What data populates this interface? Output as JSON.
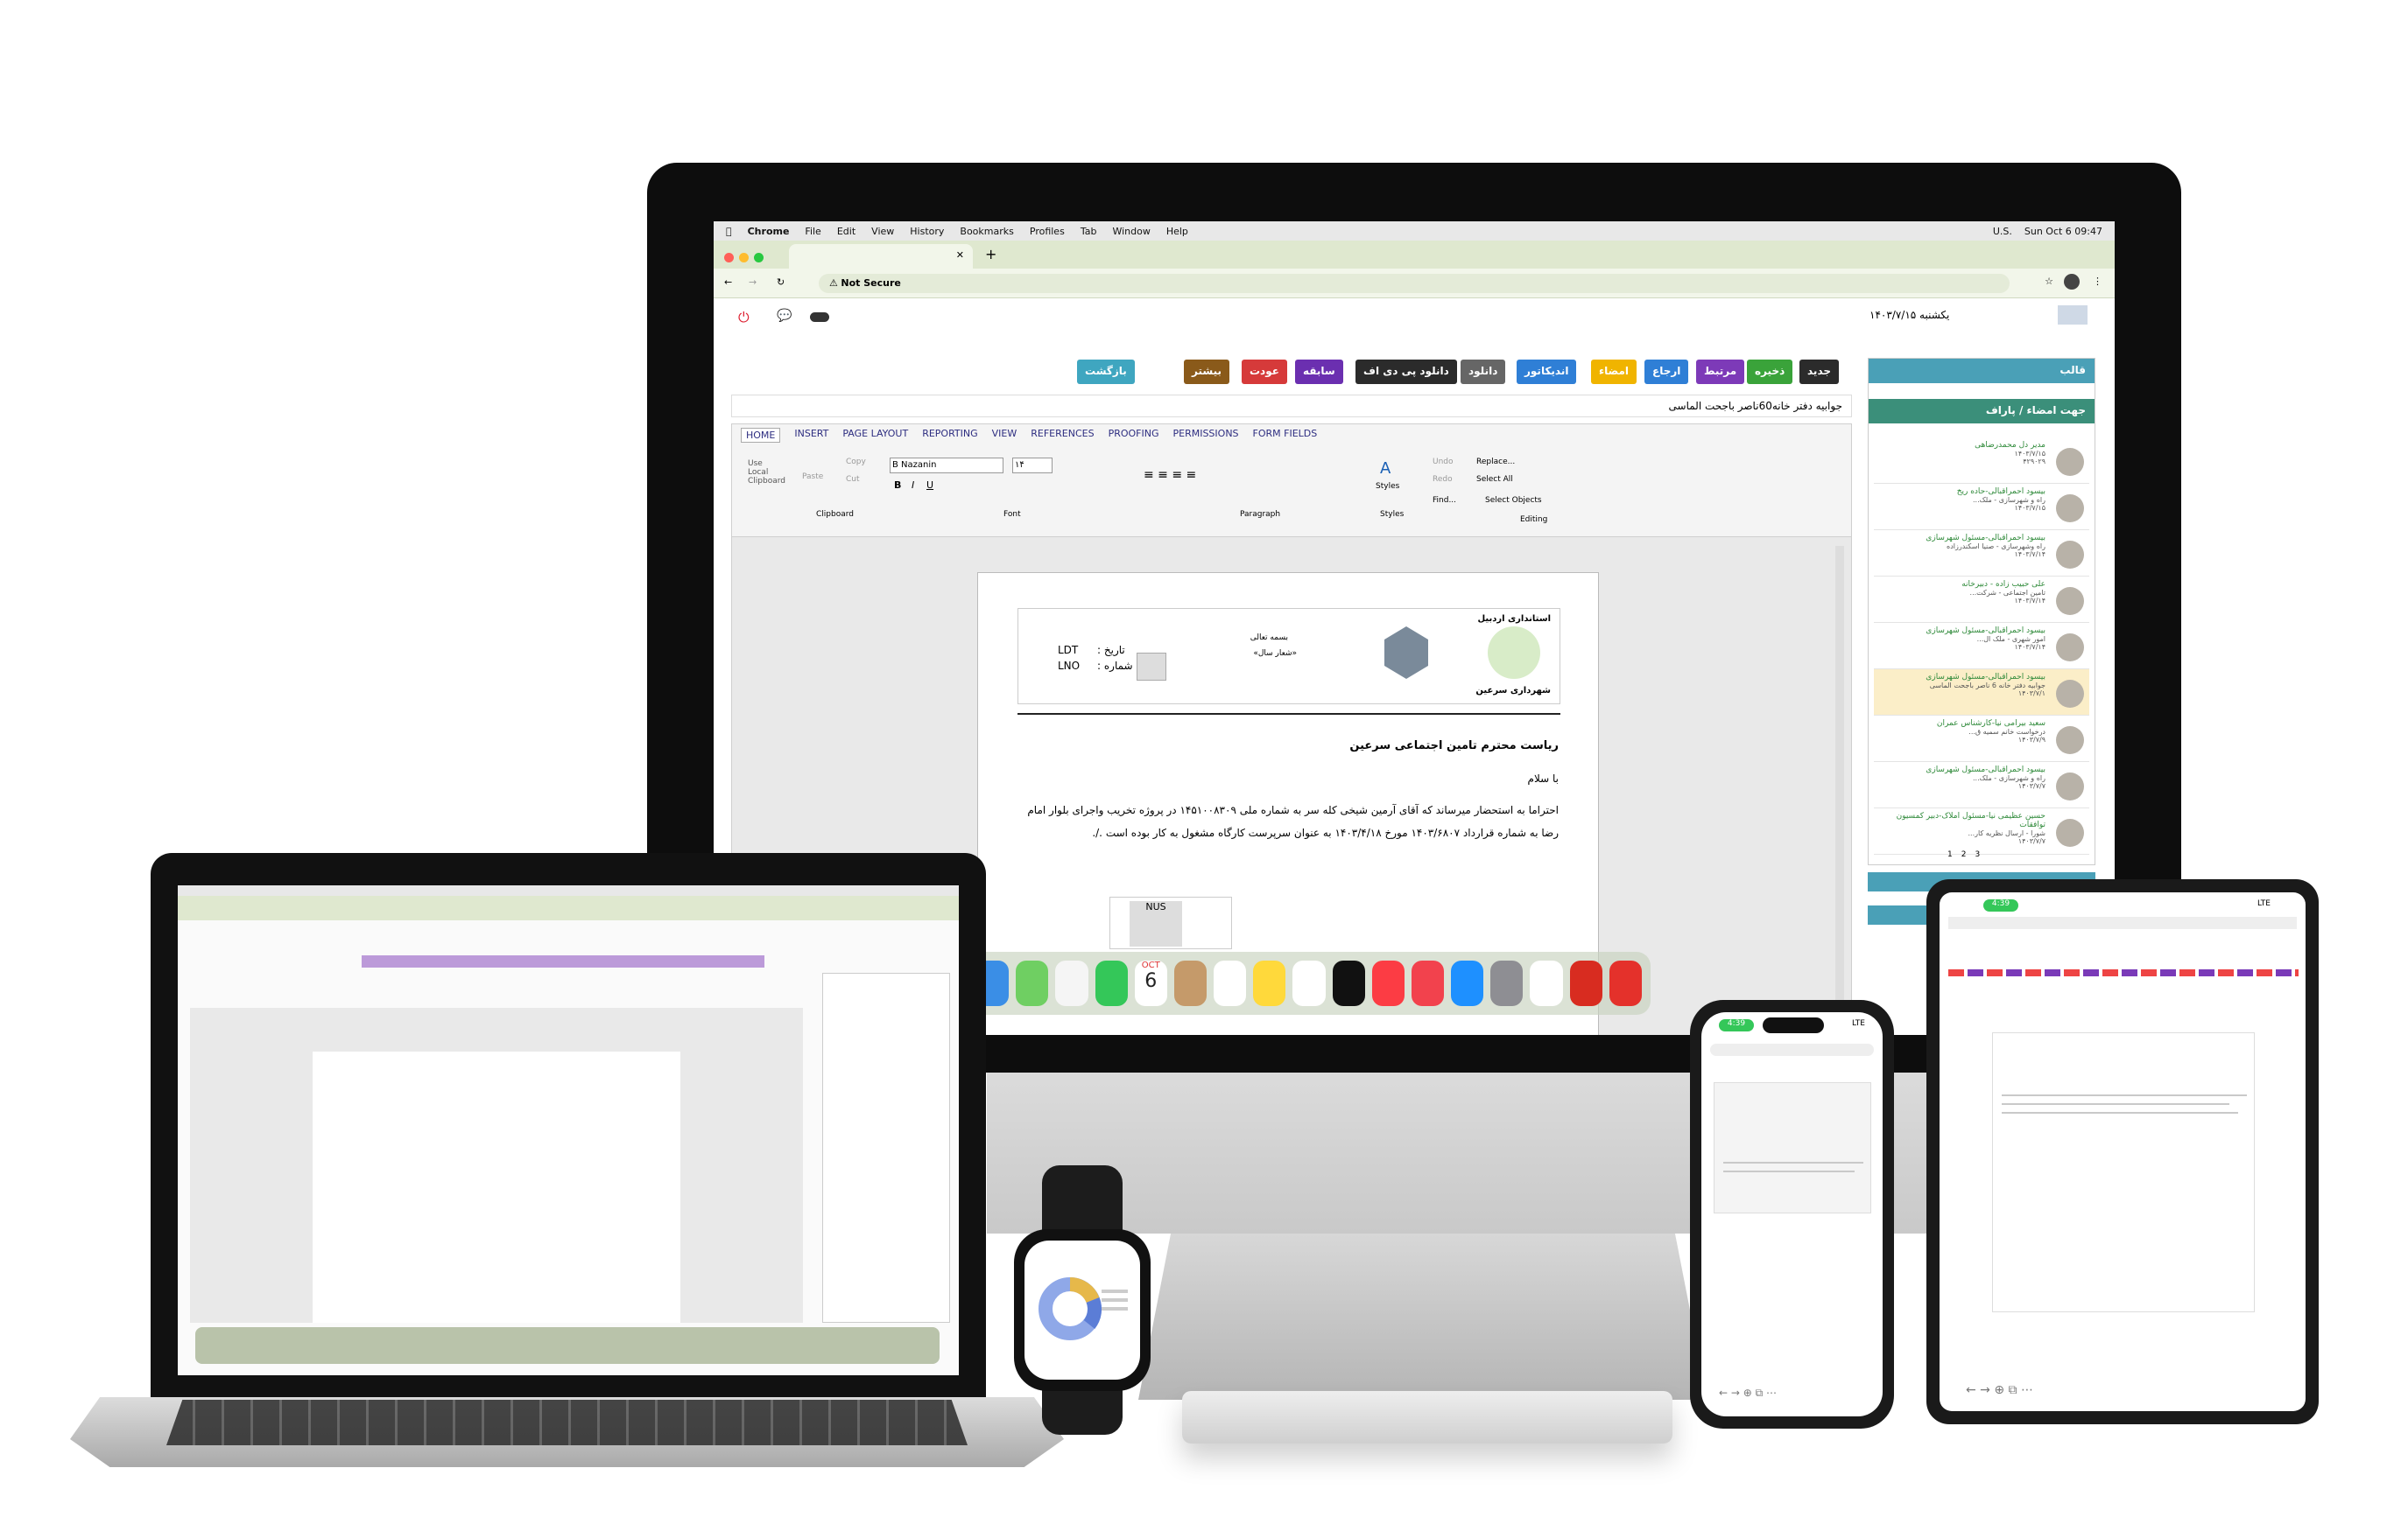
{
  "menubar": {
    "app": "Chrome",
    "items": [
      "File",
      "Edit",
      "View",
      "History",
      "Bookmarks",
      "Profiles",
      "Tab",
      "Window",
      "Help"
    ],
    "input_source": "U.S.",
    "clock": "Sun Oct 6 09:47"
  },
  "browser": {
    "security_label": "Not Secure"
  },
  "app": {
    "date": "یکشنبه ۱۴۰۳/۷/۱۵",
    "toolbar": [
      {
        "label": "جدید",
        "color": "#2b2b2b"
      },
      {
        "label": "ذخیره",
        "color": "#3aa33a"
      },
      {
        "label": "مرتبط",
        "color": "#7d3ab8"
      },
      {
        "label": "ارجاع",
        "color": "#2f7fd6"
      },
      {
        "label": "امضاء",
        "color": "#f0b400"
      },
      {
        "label": "اندیکاتور",
        "color": "#2f7fd6"
      },
      {
        "label": "دانلود",
        "color": "#666666"
      },
      {
        "label": "دانلود پی دی اف",
        "color": "#2b2b2b"
      },
      {
        "label": "سابقه",
        "color": "#6b2fb0"
      },
      {
        "label": "عودت",
        "color": "#d63a3a"
      },
      {
        "label": "بیشتر",
        "color": "#8a5a1a"
      },
      {
        "label": "بازگشت",
        "color": "#3fa6c0"
      }
    ],
    "subject": "جوابیه دفتر خانه60ناصر باجحت الماسی",
    "ribbon_tabs": [
      "HOME",
      "INSERT",
      "PAGE LAYOUT",
      "REPORTING",
      "VIEW",
      "REFERENCES",
      "PROOFING",
      "PERMISSIONS",
      "FORM FIELDS"
    ],
    "ribbon": {
      "font_name": "B Nazanin",
      "font_size": "۱۴",
      "groups": [
        "Clipboard",
        "Font",
        "Paragraph",
        "Styles",
        "Editing"
      ],
      "clipboard": {
        "use_local": "Use Local Clipboard",
        "paste": "Paste",
        "copy": "Copy",
        "cut": "Cut"
      },
      "editing": {
        "replace": "Replace...",
        "select_all": "Select All",
        "find": "Find...",
        "select_objects": "Select Objects",
        "undo": "Undo",
        "redo": "Redo"
      },
      "styles": "Styles"
    },
    "letter": {
      "org": "استانداری اردبیل",
      "municipality": "شهرداری سرعین",
      "bismillah": "بسمه تعالی",
      "motto": "«شعار سال»",
      "date_label": "تاریخ :",
      "date_value": "LDT",
      "number_label": "شماره :",
      "number_value": "LNO",
      "recipient": "ریاست محترم تامین اجتماعی سرعین",
      "greeting": "با سلام",
      "body": "احتراما به استحضار میرساند که آقای آرمین شیخی کله سر به شماره ملی ۱۴۵۱۰۰۸۳۰۹ در پروژه تخریب واجرای بلوار امام رضا به شماره قرارداد ۱۴۰۳/۶۸۰۷ مورخ ۱۴۰۳/۴/۱۸ به عنوان سرپرست کارگاه مشغول به کار بوده است ./.",
      "stamp": "NUS"
    },
    "side": {
      "title": "قالب",
      "subtitle": "جهت امضاء / پاراف",
      "items": [
        {
          "name": "مدیر دل محمدرضاهی",
          "subject": "",
          "date": "۱۴۰۳/۷/۱۵",
          "code": "۴۲۹۰۲۹"
        },
        {
          "name": "بیسود احمراقبالی-حاده ریخ",
          "subject": "راه و شهرسازی - ملک...",
          "date": "۱۴۰۳/۷/۱۵",
          "code": "۴۲۹۰۷۵"
        },
        {
          "name": "بیسود احمراقبالی-مسئول شهرسازی",
          "subject": "راه وشهرسازی - صنیا اسکندرزاده",
          "date": "۱۴۰۳/۷/۱۴",
          "code": "۴۲۸۹۳۳"
        },
        {
          "name": "علی حبیب زاده - دبیرخانه",
          "subject": "تامین اجتماعی - شرکت...",
          "date": "۱۴۰۳/۷/۱۴",
          "code": "۴۲۸۹۲۴"
        },
        {
          "name": "بیسود احمراقبالی-مسئول شهرسازی",
          "subject": "امور شهری - ملک ال...",
          "date": "۱۴۰۳/۷/۱۴",
          "code": "۴۲۸۹۱۴"
        },
        {
          "name": "بیسود احمراقبالی-مسئول شهرسازی",
          "subject": "جوابیه دفتر خانه 6 ناصر باجحت الماسی",
          "date": "۱۴۰۳/۷/۱",
          "code": "۴۲۸۷۹۳"
        },
        {
          "name": "سعید بیرامی نیا-کارشناس عمران",
          "subject": "درخواست خانم سمیه ق...",
          "date": "۱۴۰۳/۷/۹",
          "code": "۴۲۸۸۸۶"
        },
        {
          "name": "بیسود احمراقبالی-مسئول شهرسازی",
          "subject": "راه و شهرسازی - ملک...",
          "date": "۱۴۰۳/۷/۷",
          "code": "۴۲۸۸۵۳"
        },
        {
          "name": "حسین عظیمی نیا-مسئول املاک-دبیر کمسیون توافقات",
          "subject": "شورا - ارسال نظریه کار...",
          "date": "۱۴۰۳/۷/۷",
          "code": "۴۲۸۷۷۶"
        }
      ],
      "pages": [
        "1",
        "2",
        "3"
      ]
    }
  },
  "phone": {
    "time": "4:39",
    "network": "LTE"
  },
  "ipad": {
    "time": "4:39",
    "network": "LTE"
  },
  "dock": {
    "calendar_month": "OCT",
    "calendar_day": "6"
  },
  "colors": {
    "accent": "#4aa0b7",
    "chrome_tab": "#dfe8cf",
    "selected_row": "#fbeec8"
  }
}
